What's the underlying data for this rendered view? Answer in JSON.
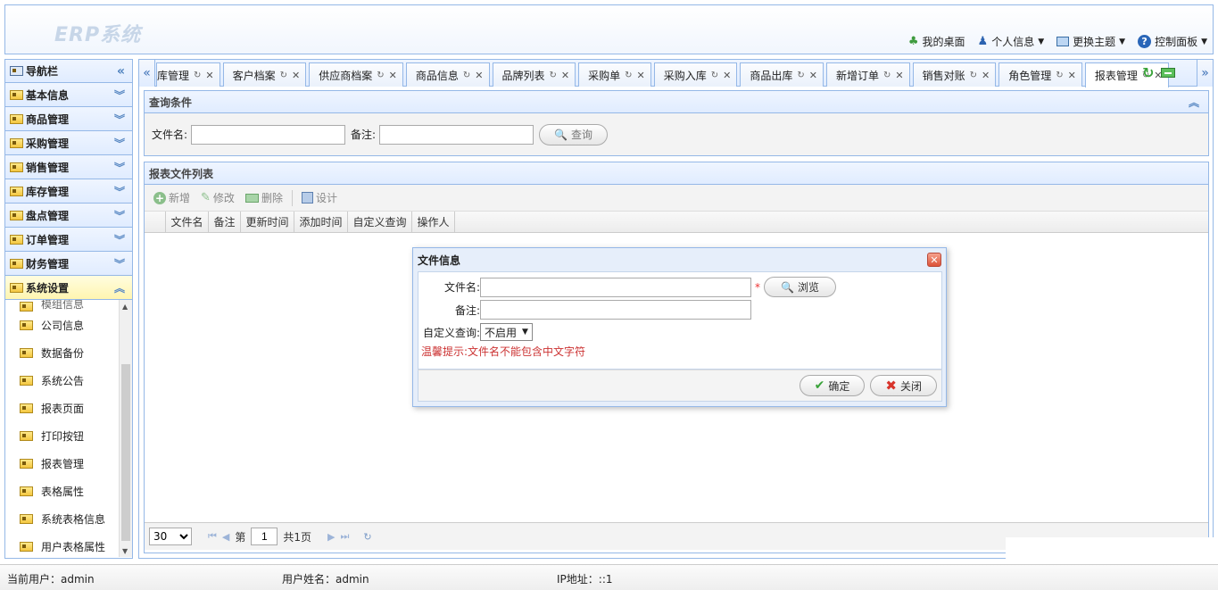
{
  "app": {
    "logo": "ERP系统",
    "links": [
      {
        "label": "我的桌面",
        "icon": "tree-icon"
      },
      {
        "label": "个人信息",
        "icon": "user-icon"
      },
      {
        "label": "更换主题",
        "icon": "monitor-icon"
      },
      {
        "label": "控制面板",
        "icon": "help-icon"
      }
    ]
  },
  "sidebar": {
    "title": "导航栏",
    "groups": [
      "基本信息",
      "商品管理",
      "采购管理",
      "销售管理",
      "库存管理",
      "盘点管理",
      "订单管理",
      "财务管理",
      "系统设置"
    ],
    "items": [
      "模组信息",
      "公司信息",
      "数据备份",
      "系统公告",
      "报表页面",
      "打印按钮",
      "报表管理",
      "表格属性",
      "系统表格信息",
      "用户表格属性"
    ]
  },
  "tabs": [
    "库管理",
    "客户档案",
    "供应商档案",
    "商品信息",
    "品牌列表",
    "采购单",
    "采购入库",
    "商品出库",
    "新增订单",
    "销售对账",
    "角色管理",
    "报表管理"
  ],
  "query": {
    "title": "查询条件",
    "filename_label": "文件名:",
    "remark_label": "备注:",
    "search_button": "查询"
  },
  "list": {
    "title": "报表文件列表",
    "toolbar": {
      "add": "新增",
      "edit": "修改",
      "delete": "删除",
      "design": "设计"
    },
    "columns": [
      "文件名",
      "备注",
      "更新时间",
      "添加时间",
      "自定义查询",
      "操作人"
    ]
  },
  "pager": {
    "page_size": "30",
    "page_prefix": "第",
    "page": "1",
    "page_suffix": "共1页"
  },
  "dialog": {
    "title": "文件信息",
    "filename_label": "文件名:",
    "required_mark": "*",
    "browse_button": "浏览",
    "remark_label": "备注:",
    "custom_query_label": "自定义查询:",
    "custom_query_value": "不启用",
    "hint": "温馨提示:文件名不能包含中文字符",
    "ok_button": "确定",
    "close_button": "关闭"
  },
  "status": {
    "current_user": "当前用户：admin",
    "user_name": "用户姓名：admin",
    "ip": "IP地址：::1"
  }
}
